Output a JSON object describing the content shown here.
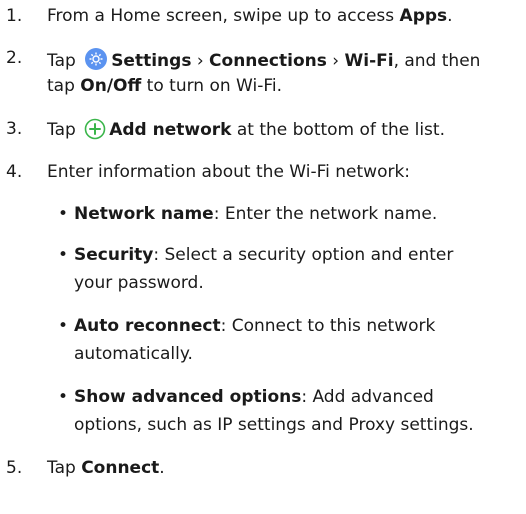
{
  "steps": [
    {
      "num": "1.",
      "lines": [
        {
          "pre": "From a Home screen, swipe up to access ",
          "b1": "Apps",
          "post": "."
        }
      ]
    },
    {
      "num": "2.",
      "lines": [
        {
          "pre": "Tap",
          "icon": "settings-icon",
          "b1": "Settings",
          "sep1": " › ",
          "b2": "Connections",
          "sep2": " › ",
          "b3": "Wi-Fi",
          "post": ", and then"
        },
        {
          "pre": "tap ",
          "b1": "On/Off",
          "post": " to turn on Wi-Fi."
        }
      ]
    },
    {
      "num": "3.",
      "lines": [
        {
          "pre": "Tap",
          "icon": "add-icon",
          "b1": "Add network",
          "post": " at the bottom of the list."
        }
      ]
    },
    {
      "num": "4.",
      "lines": [
        {
          "pre": "Enter information about the Wi-Fi network:"
        }
      ],
      "bullets": [
        {
          "lines": [
            {
              "b1": "Network name",
              "post": ": Enter the network name."
            }
          ]
        },
        {
          "lines": [
            {
              "b1": "Security",
              "post": ": Select a security option and enter"
            },
            {
              "pre": "your password."
            }
          ]
        },
        {
          "lines": [
            {
              "b1": "Auto reconnect",
              "post": ": Connect to this network"
            },
            {
              "pre": "automatically."
            }
          ]
        },
        {
          "lines": [
            {
              "b1": "Show advanced options",
              "post": ": Add advanced"
            },
            {
              "pre": "options, such as IP settings and Proxy settings."
            }
          ]
        }
      ]
    },
    {
      "num": "5.",
      "lines": [
        {
          "pre": "Tap ",
          "b1": "Connect",
          "post": "."
        }
      ]
    }
  ],
  "bullet_char": "•",
  "colors": {
    "settings_icon": "#4f8ef7",
    "add_icon": "#3ab54a"
  }
}
